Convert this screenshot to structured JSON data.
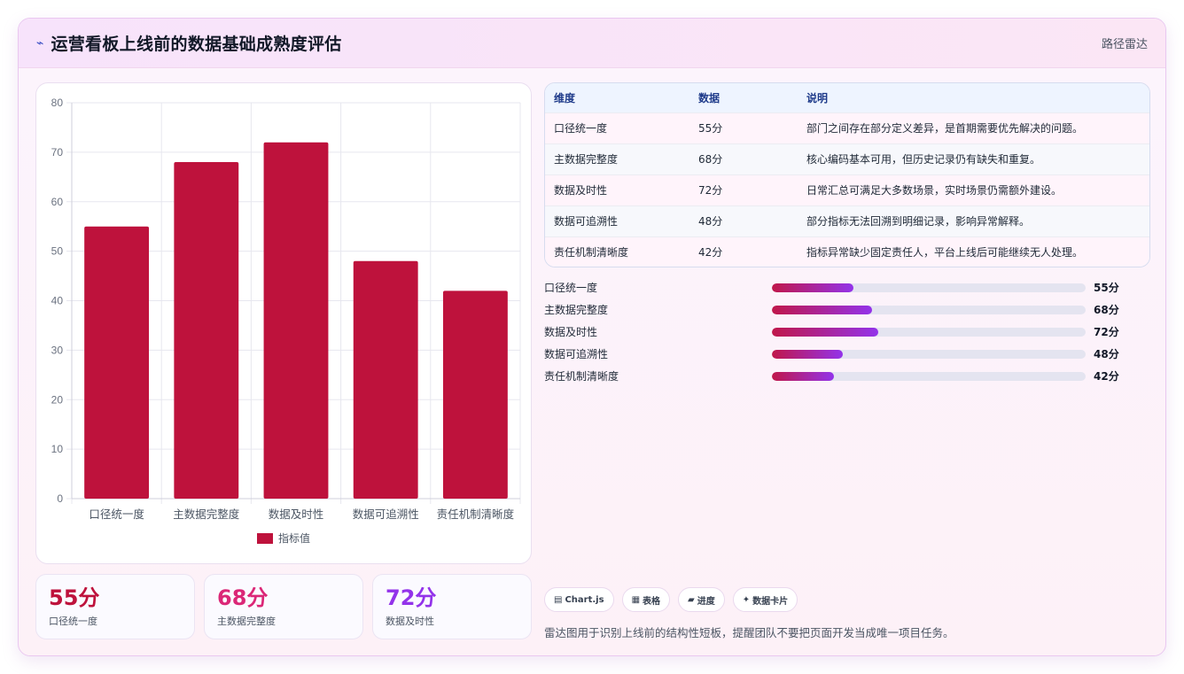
{
  "header": {
    "icon": "trend-icon",
    "title": "运营看板上线前的数据基础成熟度评估",
    "right_label": "路径雷达"
  },
  "chart_data": {
    "type": "bar",
    "categories": [
      "口径统一度",
      "主数据完整度",
      "数据及时性",
      "数据可追溯性",
      "责任机制清晰度"
    ],
    "series": [
      {
        "name": "指标值",
        "values": [
          55,
          68,
          72,
          48,
          42
        ]
      }
    ],
    "ylim": [
      0,
      80
    ],
    "yticks": [
      0,
      10,
      20,
      30,
      40,
      50,
      60,
      70,
      80
    ],
    "bar_color": "#be123c",
    "grid": true,
    "legend_position": "bottom"
  },
  "stats": [
    {
      "value": "55分",
      "label": "口径统一度",
      "color": "#be123c"
    },
    {
      "value": "68分",
      "label": "主数据完整度",
      "color": "#db2777"
    },
    {
      "value": "72分",
      "label": "数据及时性",
      "color": "#9333ea"
    }
  ],
  "table": {
    "headers": [
      "维度",
      "数据",
      "说明"
    ],
    "rows": [
      [
        "口径统一度",
        "55分",
        "部门之间存在部分定义差异，是首期需要优先解决的问题。"
      ],
      [
        "主数据完整度",
        "68分",
        "核心编码基本可用，但历史记录仍有缺失和重复。"
      ],
      [
        "数据及时性",
        "72分",
        "日常汇总可满足大多数场景，实时场景仍需额外建设。"
      ],
      [
        "数据可追溯性",
        "48分",
        "部分指标无法回溯到明细记录，影响异常解释。"
      ],
      [
        "责任机制清晰度",
        "42分",
        "指标异常缺少固定责任人，平台上线后可能继续无人处理。"
      ]
    ]
  },
  "progress": [
    {
      "label": "口径统一度",
      "value": "55分",
      "fraction": 0.26
    },
    {
      "label": "主数据完整度",
      "value": "68分",
      "fraction": 0.32
    },
    {
      "label": "数据及时性",
      "value": "72分",
      "fraction": 0.34
    },
    {
      "label": "数据可追溯性",
      "value": "48分",
      "fraction": 0.225
    },
    {
      "label": "责任机制清晰度",
      "value": "42分",
      "fraction": 0.197
    }
  ],
  "chips": [
    {
      "icon": "▤",
      "label": "Chart.js"
    },
    {
      "icon": "▦",
      "label": "表格"
    },
    {
      "icon": "▰",
      "label": "进度"
    },
    {
      "icon": "✦",
      "label": "数据卡片"
    }
  ],
  "footnote": "雷达图用于识别上线前的结构性短板，提醒团队不要把页面开发当成唯一项目任务。"
}
